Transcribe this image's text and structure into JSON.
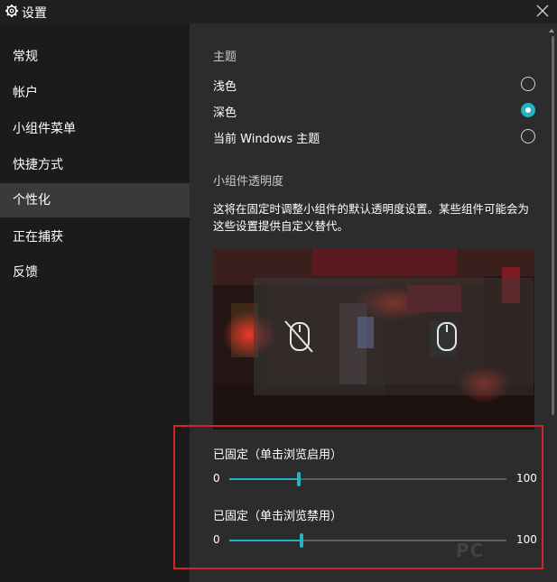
{
  "window": {
    "title": "设置",
    "icon": "gear-icon",
    "close_icon": "close-icon"
  },
  "sidebar": {
    "items": [
      {
        "label": "常规",
        "active": false
      },
      {
        "label": "帐户",
        "active": false
      },
      {
        "label": "小组件菜单",
        "active": false
      },
      {
        "label": "快捷方式",
        "active": false
      },
      {
        "label": "个性化",
        "active": true
      },
      {
        "label": "正在捕获",
        "active": false
      },
      {
        "label": "反馈",
        "active": false
      }
    ]
  },
  "theme": {
    "title": "主题",
    "options": [
      {
        "label": "浅色",
        "selected": false
      },
      {
        "label": "深色",
        "selected": true
      },
      {
        "label": "当前 Windows 主题",
        "selected": false
      }
    ]
  },
  "transparency": {
    "title": "小组件透明度",
    "description": "这将在固定时调整小组件的默认透明度设置。某些组件可能会为这些设置提供自定义替代。",
    "preview_icons": [
      "mouse-disabled-icon",
      "mouse-icon"
    ],
    "sliders": [
      {
        "label": "已固定（单击浏览启用）",
        "min_label": "0",
        "max_label": "100",
        "value": 25
      },
      {
        "label": "已固定（单击浏览禁用）",
        "min_label": "0",
        "max_label": "100",
        "value": 26
      }
    ]
  },
  "watermark": "PC",
  "colors": {
    "accent": "#23b3c6",
    "highlight_box": "#d3242b",
    "content_bg": "#2c2c2c",
    "sidebar_bg": "#1b1b1b"
  }
}
